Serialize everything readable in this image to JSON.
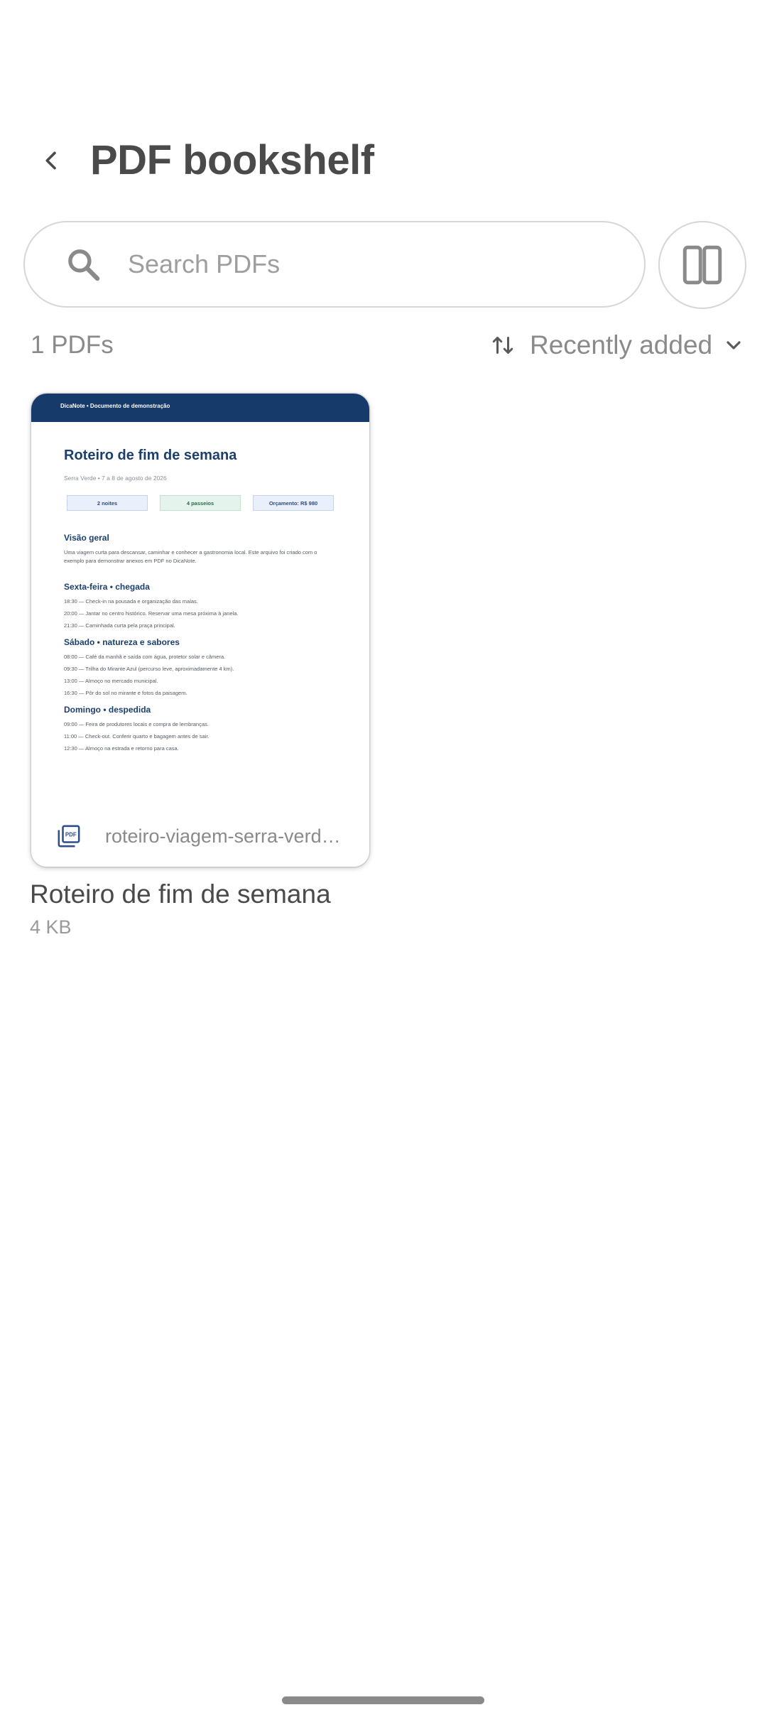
{
  "header": {
    "title": "PDF bookshelf",
    "back_icon": "arrow-back-icon"
  },
  "search": {
    "placeholder": "Search PDFs",
    "icon": "search-icon"
  },
  "toolbar": {
    "layout_icon": "split-view-icon",
    "count": "1 PDFs",
    "sort_icon": "sort-arrows-icon",
    "sort_label": "Recently added",
    "sort_chevron": "chevron-down-icon"
  },
  "pdfs": [
    {
      "title": "Roteiro de fim de semana",
      "size": "4 KB",
      "file_name": "roteiro-viagem-serra-verde.pdf",
      "file_icon": "pdf-file-icon",
      "thumbnail": {
        "header": "DicaNote  •  Documento de demonstração",
        "title": "Roteiro de fim de semana",
        "subtitle": "Serra Verde • 7 a 8 de agosto de 2026",
        "chips": [
          "2 noites",
          "4 passeios",
          "Orçamento: R$ 980"
        ],
        "sections": [
          {
            "heading": "Visão geral",
            "lines": [
              "Uma viagem curta para descansar, caminhar e conhecer a gastronomia local. Este arquivo foi criado com o",
              "exemplo para demonstrar anexos em PDF no DicaNote."
            ]
          },
          {
            "heading": "Sexta-feira • chegada",
            "lines": [
              "18:30 — Check-in na pousada e organização das malas.",
              "20:00 — Jantar no centro histórico. Reservar uma mesa próxima à janela.",
              "21:30 — Caminhada curta pela praça principal."
            ]
          },
          {
            "heading": "Sábado • natureza e sabores",
            "lines": [
              "08:00 — Café da manhã e saída com água, protetor solar e câmera.",
              "09:30 — Trilha do Mirante Azul (percurso leve, aproximadamente 4 km).",
              "13:00 — Almoço no mercado municipal.",
              "16:30 — Pôr do sol no mirante e fotos da paisagem."
            ]
          },
          {
            "heading": "Domingo • despedida",
            "lines": [
              "09:00 — Feira de produtores locais e compra de lembranças.",
              "11:00 — Check-out. Conferir quarto e bagagem antes de sair.",
              "12:30 — Almoço na estrada e retorno para casa."
            ]
          }
        ]
      }
    }
  ],
  "colors": {
    "thumb_header": "#163a69",
    "thumb_heading": "#1c3f6e",
    "text_primary": "#4a4a4a",
    "text_secondary": "#8a8a8a"
  }
}
